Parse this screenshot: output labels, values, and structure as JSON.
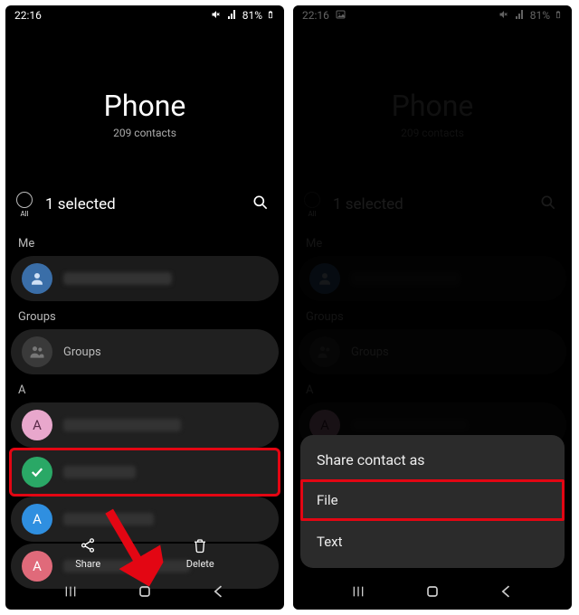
{
  "statusbar": {
    "time": "22:16",
    "battery_pct": "81%"
  },
  "header": {
    "title": "Phone",
    "subtitle": "209 contacts"
  },
  "selection": {
    "all_label": "All",
    "selected_text": "1 selected"
  },
  "sections": {
    "me": "Me",
    "groups_header": "Groups",
    "groups_label": "Groups",
    "letter_a": "A"
  },
  "contacts_a": [
    {
      "initial": "A",
      "color": "#e8a7cc"
    },
    {
      "initial": "✓",
      "color": "#2aa866",
      "selected": true
    },
    {
      "initial": "A",
      "color": "#2f8fe0"
    },
    {
      "initial": "A",
      "color": "#e06a7a"
    }
  ],
  "actions": {
    "share": "Share",
    "delete": "Delete"
  },
  "sheet": {
    "title": "Share contact as",
    "option_file": "File",
    "option_text": "Text"
  }
}
